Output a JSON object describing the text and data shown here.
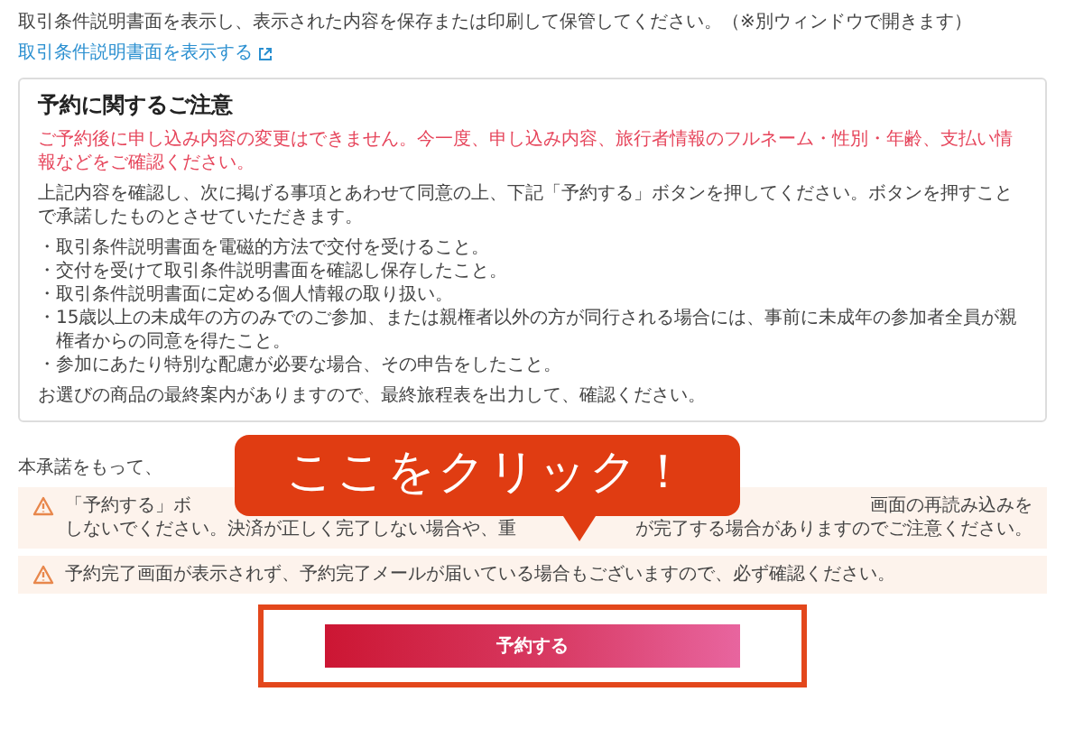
{
  "instructions": {
    "text": "取引条件説明書面を表示し、表示された内容を保存または印刷して保管してください。（※別ウィンドウで開きます）",
    "link": {
      "label": "取引条件説明書面を表示する"
    }
  },
  "notice": {
    "title": "予約に関するご注意",
    "alert": "ご予約後に申し込み内容の変更はできません。今一度、申し込み内容、旅行者情報のフルネーム・性別・年齢、支払い情報などをご確認ください。",
    "paragraph": "上記内容を確認し、次に掲げる事項とあわせて同意の上、下記「予約する」ボタンを押してください。ボタンを押すことで承諾したものとさせていただきます。",
    "items": [
      "・取引条件説明書面を電磁的方法で交付を受けること。",
      "・交付を受けて取引条件説明書面を確認し保存したこと。",
      "・取引条件説明書面に定める個人情報の取り扱い。",
      "・15歳以上の未成年の方のみでのご参加、または親権者以外の方が同行される場合には、事前に未成年の参加者全員が親権者からの同意を得たこと。",
      "・参加にあたり特別な配慮が必要な場合、その申告をしたこと。"
    ],
    "closing": "お選びの商品の最終案内がありますので、最終旅程表を出力して、確認ください。"
  },
  "consent_text": "本承諾をもって、",
  "warnings": [
    {
      "lines": [
        {
          "left": "「予約する」ボ",
          "right": "画面の再読み込みを"
        },
        {
          "left": "しないでください。決済が正しく完了しない場合や、重",
          "right": "が完了する場合がありますのでご注意ください。"
        }
      ]
    },
    {
      "lines": [
        {
          "left": "予約完了画面が表示されず、予約完了メールが届いている場合もございますので、必ず確認ください。"
        }
      ]
    }
  ],
  "callout": {
    "label": "ここをクリック！"
  },
  "submit_button": {
    "label": "予約する"
  }
}
